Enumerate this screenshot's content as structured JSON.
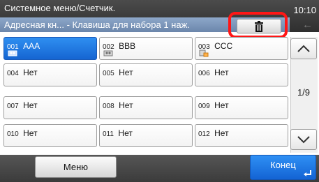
{
  "header": {
    "title": "Системное меню/Счетчик.",
    "time": "10:10",
    "subtitle": "Адресная кн... - Клавиша для набора 1 наж.",
    "back_glyph": "←"
  },
  "toolbar": {
    "delete_icon": "trash-icon",
    "highlight_color": "#ff1616"
  },
  "grid": {
    "rows": [
      [
        {
          "num": "001",
          "name": "AAA",
          "icon": "group-icon",
          "selected": true
        },
        {
          "num": "002",
          "name": "BBB",
          "icon": "group-icon",
          "selected": false
        },
        {
          "num": "003",
          "name": "CCC",
          "icon": "folder-icon",
          "selected": false
        }
      ],
      [
        {
          "num": "004",
          "name": "Нет"
        },
        {
          "num": "005",
          "name": "Нет"
        },
        {
          "num": "006",
          "name": "Нет"
        }
      ],
      [
        {
          "num": "007",
          "name": "Нет"
        },
        {
          "num": "008",
          "name": "Нет"
        },
        {
          "num": "009",
          "name": "Нет"
        }
      ],
      [
        {
          "num": "010",
          "name": "Нет"
        },
        {
          "num": "011",
          "name": "Нет"
        },
        {
          "num": "012",
          "name": "Нет"
        }
      ]
    ]
  },
  "pagination": {
    "page_text": "1/9"
  },
  "footer": {
    "menu_label": "Меню",
    "done_label": "Конец"
  },
  "colors": {
    "selected": "#1f7be8",
    "header": "#3a3a3a",
    "subheader": "#7d97bc"
  }
}
